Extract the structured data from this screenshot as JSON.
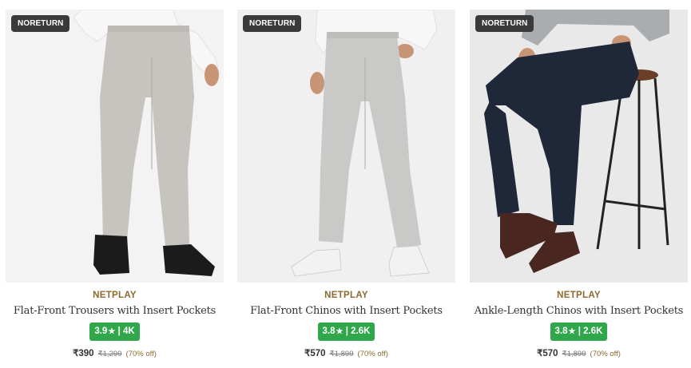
{
  "products": [
    {
      "badge": "NORETURN",
      "brand": "NETPLAY",
      "name": "Flat-Front Trousers with Insert Pockets",
      "rating": "3.9",
      "rating_count": "4K",
      "price": "₹390",
      "mrp": "₹1,299",
      "discount": "(70% off)",
      "pant_color": "#c7c4bf",
      "shoe_color": "#1b1b1b"
    },
    {
      "badge": "NORETURN",
      "brand": "NETPLAY",
      "name": "Flat-Front Chinos with Insert Pockets",
      "rating": "3.8",
      "rating_count": "2.6K",
      "price": "₹570",
      "mrp": "₹1,899",
      "discount": "(70% off)",
      "pant_color": "#c9c9c7",
      "shoe_color": "#f2f2f2"
    },
    {
      "badge": "NORETURN",
      "brand": "NETPLAY",
      "name": "Ankle-Length Chinos with Insert Pockets",
      "rating": "3.8",
      "rating_count": "2.6K",
      "price": "₹570",
      "mrp": "₹1,899",
      "discount": "(70% off)",
      "pant_color": "#1f2838",
      "shoe_color": "#4a2620"
    }
  ],
  "rating_separator": "|",
  "star_icon": "star-icon",
  "colors": {
    "badge_bg": "#3a3a3a",
    "rating_bg": "#2fa74a",
    "brand_text": "#8a6a2e"
  }
}
